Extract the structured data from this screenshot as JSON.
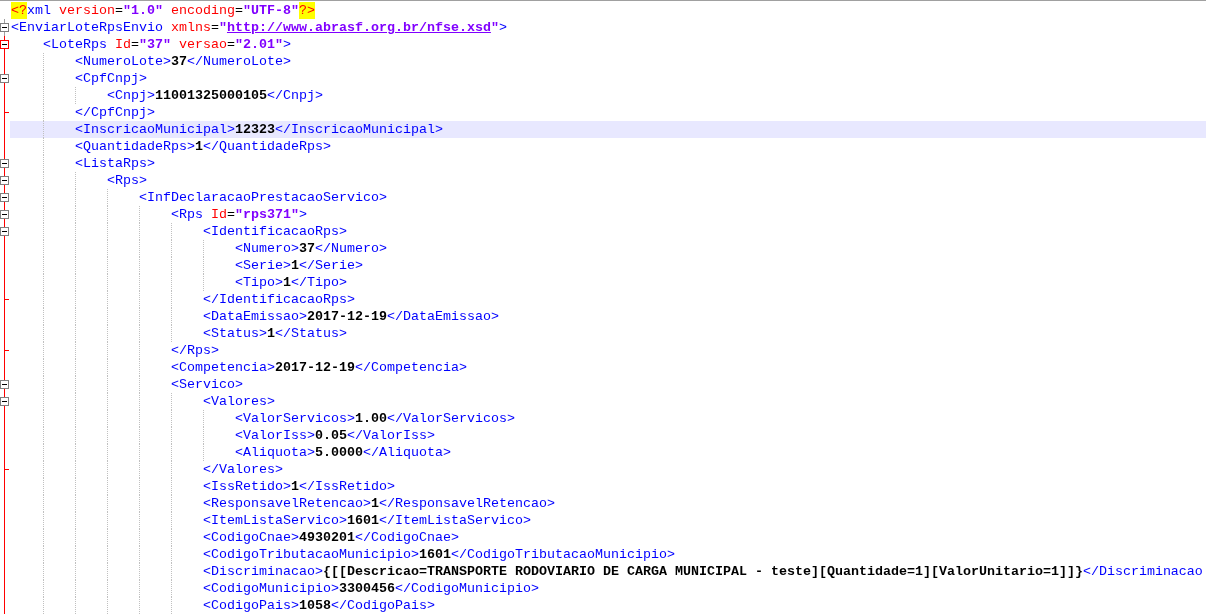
{
  "editor": {
    "lines": [
      {
        "text": "<?xml version=\"1.0\" encoding=\"UTF-8\"?>",
        "selected": false
      },
      {
        "text": "<EnviarLoteRpsEnvio xmlns=\"http://www.abrasf.org.br/nfse.xsd\">",
        "selected": false,
        "expanded": true,
        "children": [
          {
            "text": "<LoteRps Id=\"37\" versao=\"2.01\">",
            "selected": false,
            "expanded": true,
            "children": [
              {
                "text": "<NumeroLote>37</NumeroLote>",
                "selected": false
              },
              {
                "text": "<CpfCnpj>",
                "selected": false,
                "expanded": true,
                "close": "</CpfCnpj>",
                "children": [
                  {
                    "text": "<Cnpj>11001325000105</Cnpj>",
                    "selected": false
                  }
                ]
              },
              {
                "text": "<InscricaoMunicipal>12323</InscricaoMunicipal>",
                "selected": true
              },
              {
                "text": "<QuantidadeRps>1</QuantidadeRps>",
                "selected": false
              },
              {
                "text": "<ListaRps>",
                "selected": false,
                "expanded": true,
                "children": [
                  {
                    "text": "<Rps>",
                    "selected": false,
                    "expanded": true,
                    "children": [
                      {
                        "text": "<InfDeclaracaoPrestacaoServico>",
                        "selected": false,
                        "expanded": true,
                        "children": [
                          {
                            "text": "<Rps Id=\"rps371\">",
                            "selected": false,
                            "expanded": true,
                            "close": "</Rps>",
                            "children": [
                              {
                                "text": "<IdentificacaoRps>",
                                "selected": false,
                                "expanded": true,
                                "close": "</IdentificacaoRps>",
                                "children": [
                                  {
                                    "text": "<Numero>37</Numero>",
                                    "selected": false
                                  },
                                  {
                                    "text": "<Serie>1</Serie>",
                                    "selected": false
                                  },
                                  {
                                    "text": "<Tipo>1</Tipo>",
                                    "selected": false
                                  }
                                ]
                              },
                              {
                                "text": "<DataEmissao>2017-12-19</DataEmissao>",
                                "selected": false
                              },
                              {
                                "text": "<Status>1</Status>",
                                "selected": false
                              }
                            ]
                          },
                          {
                            "text": "<Competencia>2017-12-19</Competencia>",
                            "selected": false
                          },
                          {
                            "text": "<Servico>",
                            "selected": false,
                            "expanded": true,
                            "children": [
                              {
                                "text": "<Valores>",
                                "selected": false,
                                "expanded": true,
                                "close": "</Valores>",
                                "children": [
                                  {
                                    "text": "<ValorServicos>1.00</ValorServicos>",
                                    "selected": false
                                  },
                                  {
                                    "text": "<ValorIss>0.05</ValorIss>",
                                    "selected": false
                                  },
                                  {
                                    "text": "<Aliquota>5.0000</Aliquota>",
                                    "selected": false
                                  }
                                ]
                              },
                              {
                                "text": "<IssRetido>1</IssRetido>",
                                "selected": false
                              },
                              {
                                "text": "<ResponsavelRetencao>1</ResponsavelRetencao>",
                                "selected": false
                              },
                              {
                                "text": "<ItemListaServico>1601</ItemListaServico>",
                                "selected": false
                              },
                              {
                                "text": "<CodigoCnae>4930201</CodigoCnae>",
                                "selected": false
                              },
                              {
                                "text": "<CodigoTributacaoMunicipio>1601</CodigoTributacaoMunicipio>",
                                "selected": false
                              },
                              {
                                "text": "<Discriminacao>{[[Descricao=TRANSPORTE RODOVIARIO DE CARGA MUNICIPAL - teste][Quantidade=1][ValorUnitario=1]]}</Discriminacao",
                                "selected": false
                              },
                              {
                                "text": "<CodigoMunicipio>3300456</CodigoMunicipio>",
                                "selected": false
                              },
                              {
                                "text": "<CodigoPais>1058</CodigoPais>",
                                "selected": false
                              }
                            ]
                          }
                        ]
                      }
                    ]
                  }
                ]
              }
            ]
          }
        ]
      }
    ]
  }
}
